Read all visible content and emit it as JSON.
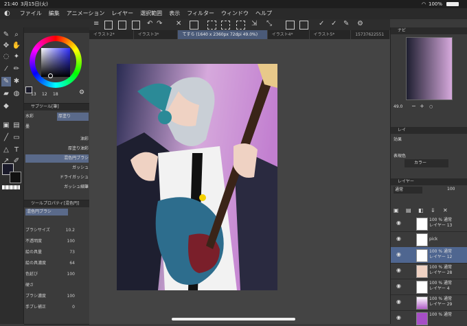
{
  "status": {
    "time": "21:40",
    "date": "3月15日(火)",
    "battery": "100%"
  },
  "menu": [
    "ファイル",
    "編集",
    "アニメーション",
    "レイヤー",
    "選択範囲",
    "表示",
    "フィルター",
    "ウィンドウ",
    "ヘルプ"
  ],
  "tabs": [
    "イラスト2*",
    "イラスト3*",
    "てすら (1640 x 2360px 72dpi 49.0%)",
    "イラスト4*",
    "イラスト5*",
    "15737622551"
  ],
  "colors": {
    "accent": "#4f6690",
    "panel": "#3b3b3b",
    "dark": "#2a2a2a"
  },
  "color_panel": {
    "values": [
      "13",
      "12",
      "18"
    ]
  },
  "subtool": {
    "title": "サブツール[筆]",
    "groups": [
      "水彩",
      "厚塗り",
      "墨"
    ],
    "brushes": [
      "油彩",
      "厚塗り油彩",
      "混色円ブラシ",
      "ガッシュ",
      "ドライガッシュ",
      "ガッシュ細筆"
    ]
  },
  "tool_property": {
    "title": "ツールプロパティ[混色円]",
    "brush_name": "混色円ブラシ",
    "rows": [
      {
        "label": "ブラシサイズ",
        "value": "10.2"
      },
      {
        "label": "不透明度",
        "value": "100"
      },
      {
        "label": "絵の具量",
        "value": "73"
      },
      {
        "label": "絵の具濃度",
        "value": "64"
      },
      {
        "label": "色延び",
        "value": "100"
      },
      {
        "label": "硬さ",
        "value": ""
      },
      {
        "label": "ブラシ濃度",
        "value": "100"
      },
      {
        "label": "手ブレ補正",
        "value": "0"
      }
    ]
  },
  "navigator": {
    "title": "ナビ",
    "zoom": "49.0"
  },
  "layer_property": {
    "tab": "レイ",
    "effect_label": "効果",
    "expression_label": "表現色",
    "expression_value": "カラー"
  },
  "layers_panel": {
    "title": "レイヤー",
    "blend_mode": "通常",
    "opacity": "100",
    "items": [
      {
        "opacity": "100 %",
        "mode": "通常",
        "name": "レイヤー 13",
        "selected": false
      },
      {
        "opacity": "",
        "mode": "",
        "name": "pick",
        "selected": false
      },
      {
        "opacity": "100 %",
        "mode": "通常",
        "name": "レイヤー 12",
        "selected": true
      },
      {
        "opacity": "100 %",
        "mode": "通常",
        "name": "レイヤー 28",
        "selected": false
      },
      {
        "opacity": "100 %",
        "mode": "通常",
        "name": "レイヤー 4",
        "selected": false
      },
      {
        "opacity": "100 %",
        "mode": "通常",
        "name": "レイヤー 29",
        "selected": false
      },
      {
        "opacity": "100 %",
        "mode": "通常",
        "name": "",
        "selected": false
      }
    ]
  }
}
